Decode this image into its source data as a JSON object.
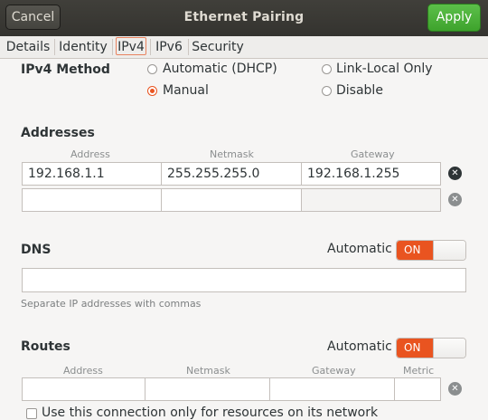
{
  "header": {
    "title": "Ethernet Pairing",
    "cancel_label": "Cancel",
    "apply_label": "Apply"
  },
  "tabs": [
    {
      "label": "Details"
    },
    {
      "label": "Identity"
    },
    {
      "label": "IPv4",
      "active": true
    },
    {
      "label": "IPv6"
    },
    {
      "label": "Security"
    }
  ],
  "ipv4_method": {
    "label": "IPv4 Method",
    "options": [
      {
        "label": "Automatic (DHCP)",
        "selected": false
      },
      {
        "label": "Link-Local Only",
        "selected": false
      },
      {
        "label": "Manual",
        "selected": true
      },
      {
        "label": "Disable",
        "selected": false
      }
    ]
  },
  "addresses": {
    "title": "Addresses",
    "columns": [
      "Address",
      "Netmask",
      "Gateway"
    ],
    "rows": [
      {
        "address": "192.168.1.1",
        "netmask": "255.255.255.0",
        "gateway": "192.168.1.255"
      },
      {
        "address": "",
        "netmask": "",
        "gateway": ""
      }
    ]
  },
  "dns": {
    "title": "DNS",
    "automatic_label": "Automatic",
    "toggle": "ON",
    "value": "",
    "hint": "Separate IP addresses with commas"
  },
  "routes": {
    "title": "Routes",
    "automatic_label": "Automatic",
    "toggle": "ON",
    "columns": [
      "Address",
      "Netmask",
      "Gateway",
      "Metric"
    ],
    "rows": [
      {
        "address": "",
        "netmask": "",
        "gateway": "",
        "metric": ""
      }
    ],
    "only_local_label": "Use this connection only for resources on its network"
  },
  "colors": {
    "accent": "#e95420",
    "apply": "#4cb23a",
    "header": "#3c3b37"
  }
}
